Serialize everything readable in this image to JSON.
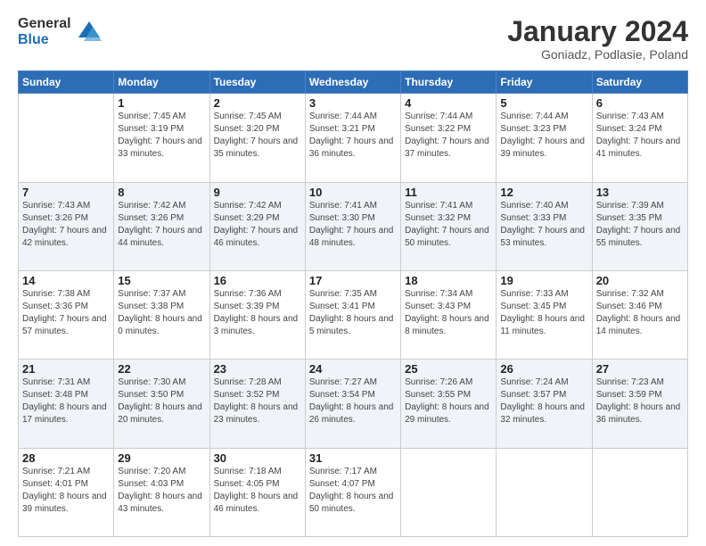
{
  "logo": {
    "general": "General",
    "blue": "Blue"
  },
  "title": "January 2024",
  "location": "Goniadz, Podlasie, Poland",
  "weekdays": [
    "Sunday",
    "Monday",
    "Tuesday",
    "Wednesday",
    "Thursday",
    "Friday",
    "Saturday"
  ],
  "weeks": [
    [
      {
        "day": "",
        "sunrise": "",
        "sunset": "",
        "daylight": ""
      },
      {
        "day": "1",
        "sunrise": "7:45 AM",
        "sunset": "3:19 PM",
        "daylight": "7 hours and 33 minutes."
      },
      {
        "day": "2",
        "sunrise": "7:45 AM",
        "sunset": "3:20 PM",
        "daylight": "7 hours and 35 minutes."
      },
      {
        "day": "3",
        "sunrise": "7:44 AM",
        "sunset": "3:21 PM",
        "daylight": "7 hours and 36 minutes."
      },
      {
        "day": "4",
        "sunrise": "7:44 AM",
        "sunset": "3:22 PM",
        "daylight": "7 hours and 37 minutes."
      },
      {
        "day": "5",
        "sunrise": "7:44 AM",
        "sunset": "3:23 PM",
        "daylight": "7 hours and 39 minutes."
      },
      {
        "day": "6",
        "sunrise": "7:43 AM",
        "sunset": "3:24 PM",
        "daylight": "7 hours and 41 minutes."
      }
    ],
    [
      {
        "day": "7",
        "sunrise": "7:43 AM",
        "sunset": "3:26 PM",
        "daylight": "7 hours and 42 minutes."
      },
      {
        "day": "8",
        "sunrise": "7:42 AM",
        "sunset": "3:26 PM",
        "daylight": "7 hours and 44 minutes."
      },
      {
        "day": "9",
        "sunrise": "7:42 AM",
        "sunset": "3:29 PM",
        "daylight": "7 hours and 46 minutes."
      },
      {
        "day": "10",
        "sunrise": "7:41 AM",
        "sunset": "3:30 PM",
        "daylight": "7 hours and 48 minutes."
      },
      {
        "day": "11",
        "sunrise": "7:41 AM",
        "sunset": "3:32 PM",
        "daylight": "7 hours and 50 minutes."
      },
      {
        "day": "12",
        "sunrise": "7:40 AM",
        "sunset": "3:33 PM",
        "daylight": "7 hours and 53 minutes."
      },
      {
        "day": "13",
        "sunrise": "7:39 AM",
        "sunset": "3:35 PM",
        "daylight": "7 hours and 55 minutes."
      }
    ],
    [
      {
        "day": "14",
        "sunrise": "7:38 AM",
        "sunset": "3:36 PM",
        "daylight": "7 hours and 57 minutes."
      },
      {
        "day": "15",
        "sunrise": "7:37 AM",
        "sunset": "3:38 PM",
        "daylight": "8 hours and 0 minutes."
      },
      {
        "day": "16",
        "sunrise": "7:36 AM",
        "sunset": "3:39 PM",
        "daylight": "8 hours and 3 minutes."
      },
      {
        "day": "17",
        "sunrise": "7:35 AM",
        "sunset": "3:41 PM",
        "daylight": "8 hours and 5 minutes."
      },
      {
        "day": "18",
        "sunrise": "7:34 AM",
        "sunset": "3:43 PM",
        "daylight": "8 hours and 8 minutes."
      },
      {
        "day": "19",
        "sunrise": "7:33 AM",
        "sunset": "3:45 PM",
        "daylight": "8 hours and 11 minutes."
      },
      {
        "day": "20",
        "sunrise": "7:32 AM",
        "sunset": "3:46 PM",
        "daylight": "8 hours and 14 minutes."
      }
    ],
    [
      {
        "day": "21",
        "sunrise": "7:31 AM",
        "sunset": "3:48 PM",
        "daylight": "8 hours and 17 minutes."
      },
      {
        "day": "22",
        "sunrise": "7:30 AM",
        "sunset": "3:50 PM",
        "daylight": "8 hours and 20 minutes."
      },
      {
        "day": "23",
        "sunrise": "7:28 AM",
        "sunset": "3:52 PM",
        "daylight": "8 hours and 23 minutes."
      },
      {
        "day": "24",
        "sunrise": "7:27 AM",
        "sunset": "3:54 PM",
        "daylight": "8 hours and 26 minutes."
      },
      {
        "day": "25",
        "sunrise": "7:26 AM",
        "sunset": "3:55 PM",
        "daylight": "8 hours and 29 minutes."
      },
      {
        "day": "26",
        "sunrise": "7:24 AM",
        "sunset": "3:57 PM",
        "daylight": "8 hours and 32 minutes."
      },
      {
        "day": "27",
        "sunrise": "7:23 AM",
        "sunset": "3:59 PM",
        "daylight": "8 hours and 36 minutes."
      }
    ],
    [
      {
        "day": "28",
        "sunrise": "7:21 AM",
        "sunset": "4:01 PM",
        "daylight": "8 hours and 39 minutes."
      },
      {
        "day": "29",
        "sunrise": "7:20 AM",
        "sunset": "4:03 PM",
        "daylight": "8 hours and 43 minutes."
      },
      {
        "day": "30",
        "sunrise": "7:18 AM",
        "sunset": "4:05 PM",
        "daylight": "8 hours and 46 minutes."
      },
      {
        "day": "31",
        "sunrise": "7:17 AM",
        "sunset": "4:07 PM",
        "daylight": "8 hours and 50 minutes."
      },
      {
        "day": "",
        "sunrise": "",
        "sunset": "",
        "daylight": ""
      },
      {
        "day": "",
        "sunrise": "",
        "sunset": "",
        "daylight": ""
      },
      {
        "day": "",
        "sunrise": "",
        "sunset": "",
        "daylight": ""
      }
    ]
  ]
}
